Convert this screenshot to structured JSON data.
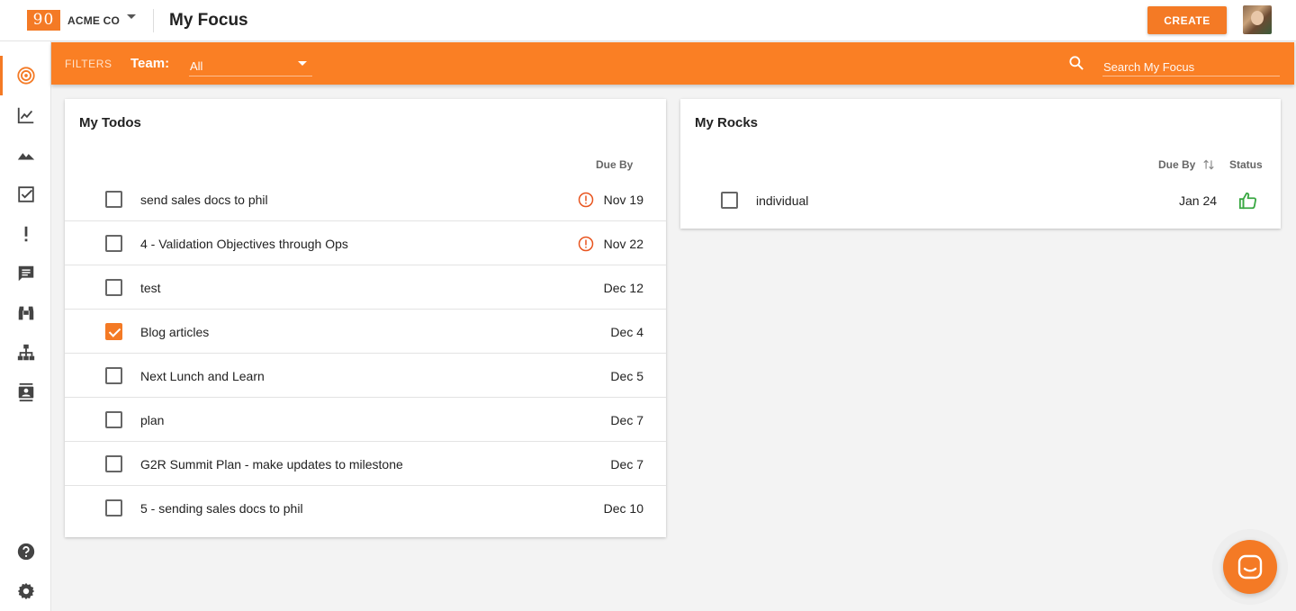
{
  "header": {
    "logo_text": "90",
    "company": "ACME CO",
    "page_title": "My Focus",
    "create_label": "CREATE"
  },
  "sidebar": {
    "items": [
      {
        "icon": "target-icon",
        "active": true
      },
      {
        "icon": "line-chart-icon"
      },
      {
        "icon": "mountain-icon"
      },
      {
        "icon": "checkbox-icon"
      },
      {
        "icon": "exclamation-icon"
      },
      {
        "icon": "message-icon"
      },
      {
        "icon": "binoculars-icon"
      },
      {
        "icon": "org-chart-icon"
      },
      {
        "icon": "contact-card-icon"
      }
    ],
    "bottom_items": [
      {
        "icon": "help-icon"
      },
      {
        "icon": "settings-icon"
      }
    ]
  },
  "filters": {
    "label": "FILTERS",
    "team_label": "Team:",
    "team_value": "All",
    "search_placeholder": "Search My Focus"
  },
  "todos": {
    "title": "My Todos",
    "due_header": "Due By",
    "items": [
      {
        "label": "send sales docs to phil",
        "due": "Nov 19",
        "overdue": true,
        "checked": false
      },
      {
        "label": "4 - Validation Objectives through Ops",
        "due": "Nov 22",
        "overdue": true,
        "checked": false
      },
      {
        "label": "test",
        "due": "Dec 12",
        "overdue": false,
        "checked": false
      },
      {
        "label": "Blog articles",
        "due": "Dec 4",
        "overdue": false,
        "checked": true
      },
      {
        "label": "Next Lunch and Learn",
        "due": "Dec 5",
        "overdue": false,
        "checked": false
      },
      {
        "label": "plan",
        "due": "Dec 7",
        "overdue": false,
        "checked": false
      },
      {
        "label": "G2R Summit Plan - make updates to milestone",
        "due": "Dec 7",
        "overdue": false,
        "checked": false
      },
      {
        "label": "5 - sending sales docs to phil",
        "due": "Dec 10",
        "overdue": false,
        "checked": false
      }
    ]
  },
  "rocks": {
    "title": "My Rocks",
    "due_header": "Due By",
    "status_header": "Status",
    "items": [
      {
        "label": "individual",
        "due": "Jan 24",
        "status": "thumbs-up-icon",
        "checked": false
      }
    ]
  },
  "colors": {
    "accent": "#f47a25",
    "filter_bar": "#fa7f24",
    "overdue": "#e8541e",
    "status_good": "#3aa843"
  }
}
